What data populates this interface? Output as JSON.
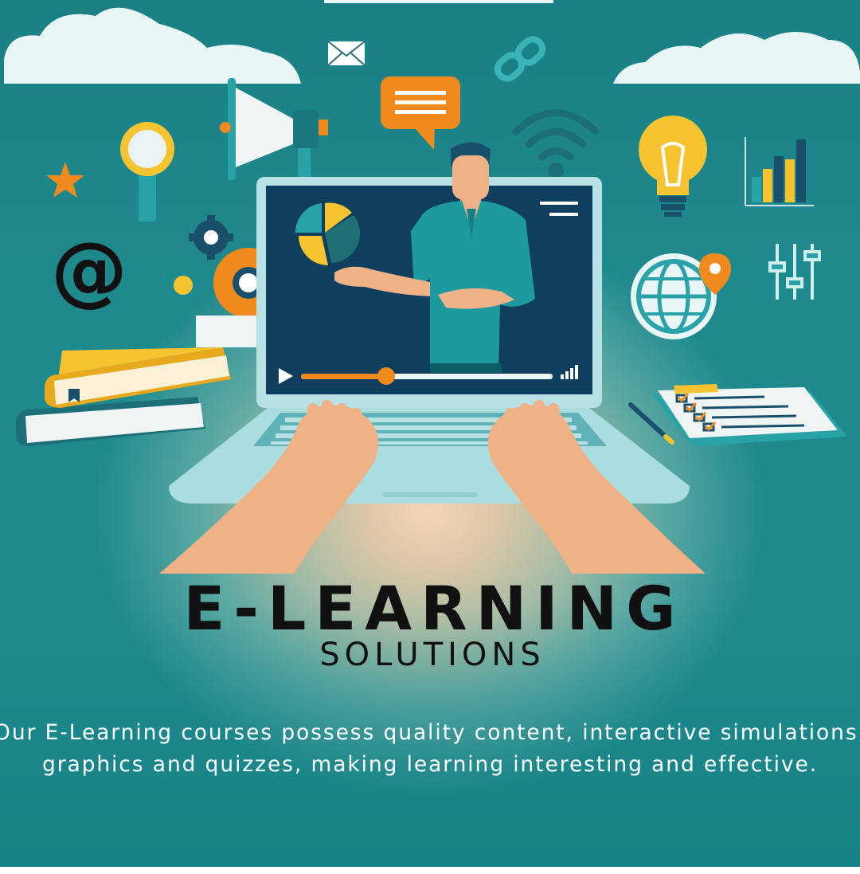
{
  "poster": {
    "title": "E-LEARNING",
    "subtitle": "SOLUTIONS",
    "description_line1": "Our E-Learning courses possess quality content, interactive simulations,",
    "description_line2": "graphics and quizzes, making learning interesting and effective."
  },
  "colors": {
    "background_teal": "#1f8a8e",
    "background_glow": "#f5d6b6",
    "screen_navy": "#0f3e5e",
    "accent_orange": "#f18a1c",
    "accent_yellow": "#f6c431",
    "accent_teal": "#2aa3a8"
  },
  "icons": [
    "envelope-icon",
    "link-icon",
    "chat-bubble-icon",
    "wifi-icon",
    "megaphone-icon",
    "magnifier-icon",
    "star-icon",
    "at-sign-icon",
    "gears-icon",
    "lightbulb-icon",
    "bar-chart-icon",
    "sliders-icon",
    "globe-location-icon",
    "books-icon",
    "pen-icon",
    "checklist-clipboard-icon",
    "pie-chart-icon",
    "play-icon",
    "volume-icon"
  ],
  "video": {
    "progress": 0.34
  }
}
